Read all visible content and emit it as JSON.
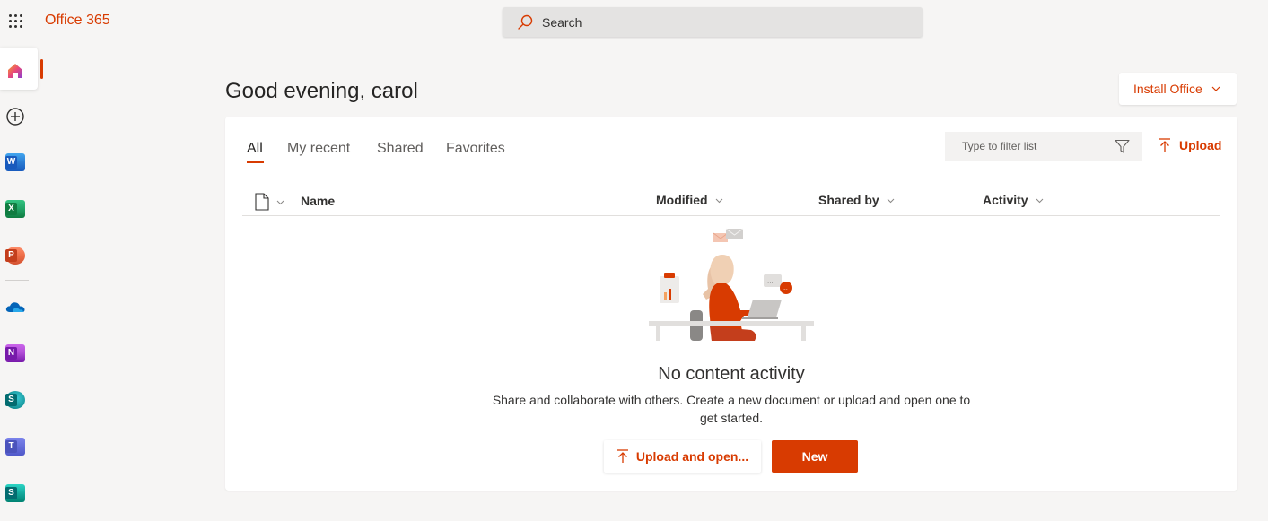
{
  "header": {
    "brand": "Office 365",
    "search_placeholder": "Search"
  },
  "rail": {
    "items": [
      {
        "name": "Home",
        "icon": "home-icon"
      },
      {
        "name": "Create",
        "icon": "add-circle-icon"
      },
      {
        "name": "Word",
        "icon": "word-icon",
        "letter": "W"
      },
      {
        "name": "Excel",
        "icon": "excel-icon",
        "letter": "X"
      },
      {
        "name": "PowerPoint",
        "icon": "powerpoint-icon",
        "letter": "P"
      },
      {
        "name": "OneDrive",
        "icon": "onedrive-icon"
      },
      {
        "name": "OneNote",
        "icon": "onenote-icon",
        "letter": "N"
      },
      {
        "name": "SharePoint",
        "icon": "sharepoint-icon",
        "letter": "S"
      },
      {
        "name": "Teams",
        "icon": "teams-icon",
        "letter": "T"
      },
      {
        "name": "Sway",
        "icon": "sway-icon",
        "letter": "S"
      }
    ]
  },
  "main": {
    "greeting": "Good evening, carol",
    "install_label": "Install Office",
    "tabs": [
      "All",
      "My recent",
      "Shared",
      "Favorites"
    ],
    "filter_placeholder": "Type to filter list",
    "upload_label": "Upload",
    "columns": {
      "name": "Name",
      "modified": "Modified",
      "shared_by": "Shared by",
      "activity": "Activity"
    },
    "empty": {
      "title": "No content activity",
      "description": "Share and collaborate with others. Create a new document or upload and open one to get started.",
      "upload_open_label": "Upload and open...",
      "new_label": "New"
    }
  },
  "colors": {
    "accent": "#d83b01",
    "background": "#f6f5f4",
    "word": "#185abd",
    "excel": "#107c41",
    "powerpoint": "#c43e1c",
    "onedrive": "#0364b8",
    "onenote": "#7719aa",
    "sharepoint": "#036c70",
    "teams": "#4b53bc",
    "sway": "#008272"
  }
}
